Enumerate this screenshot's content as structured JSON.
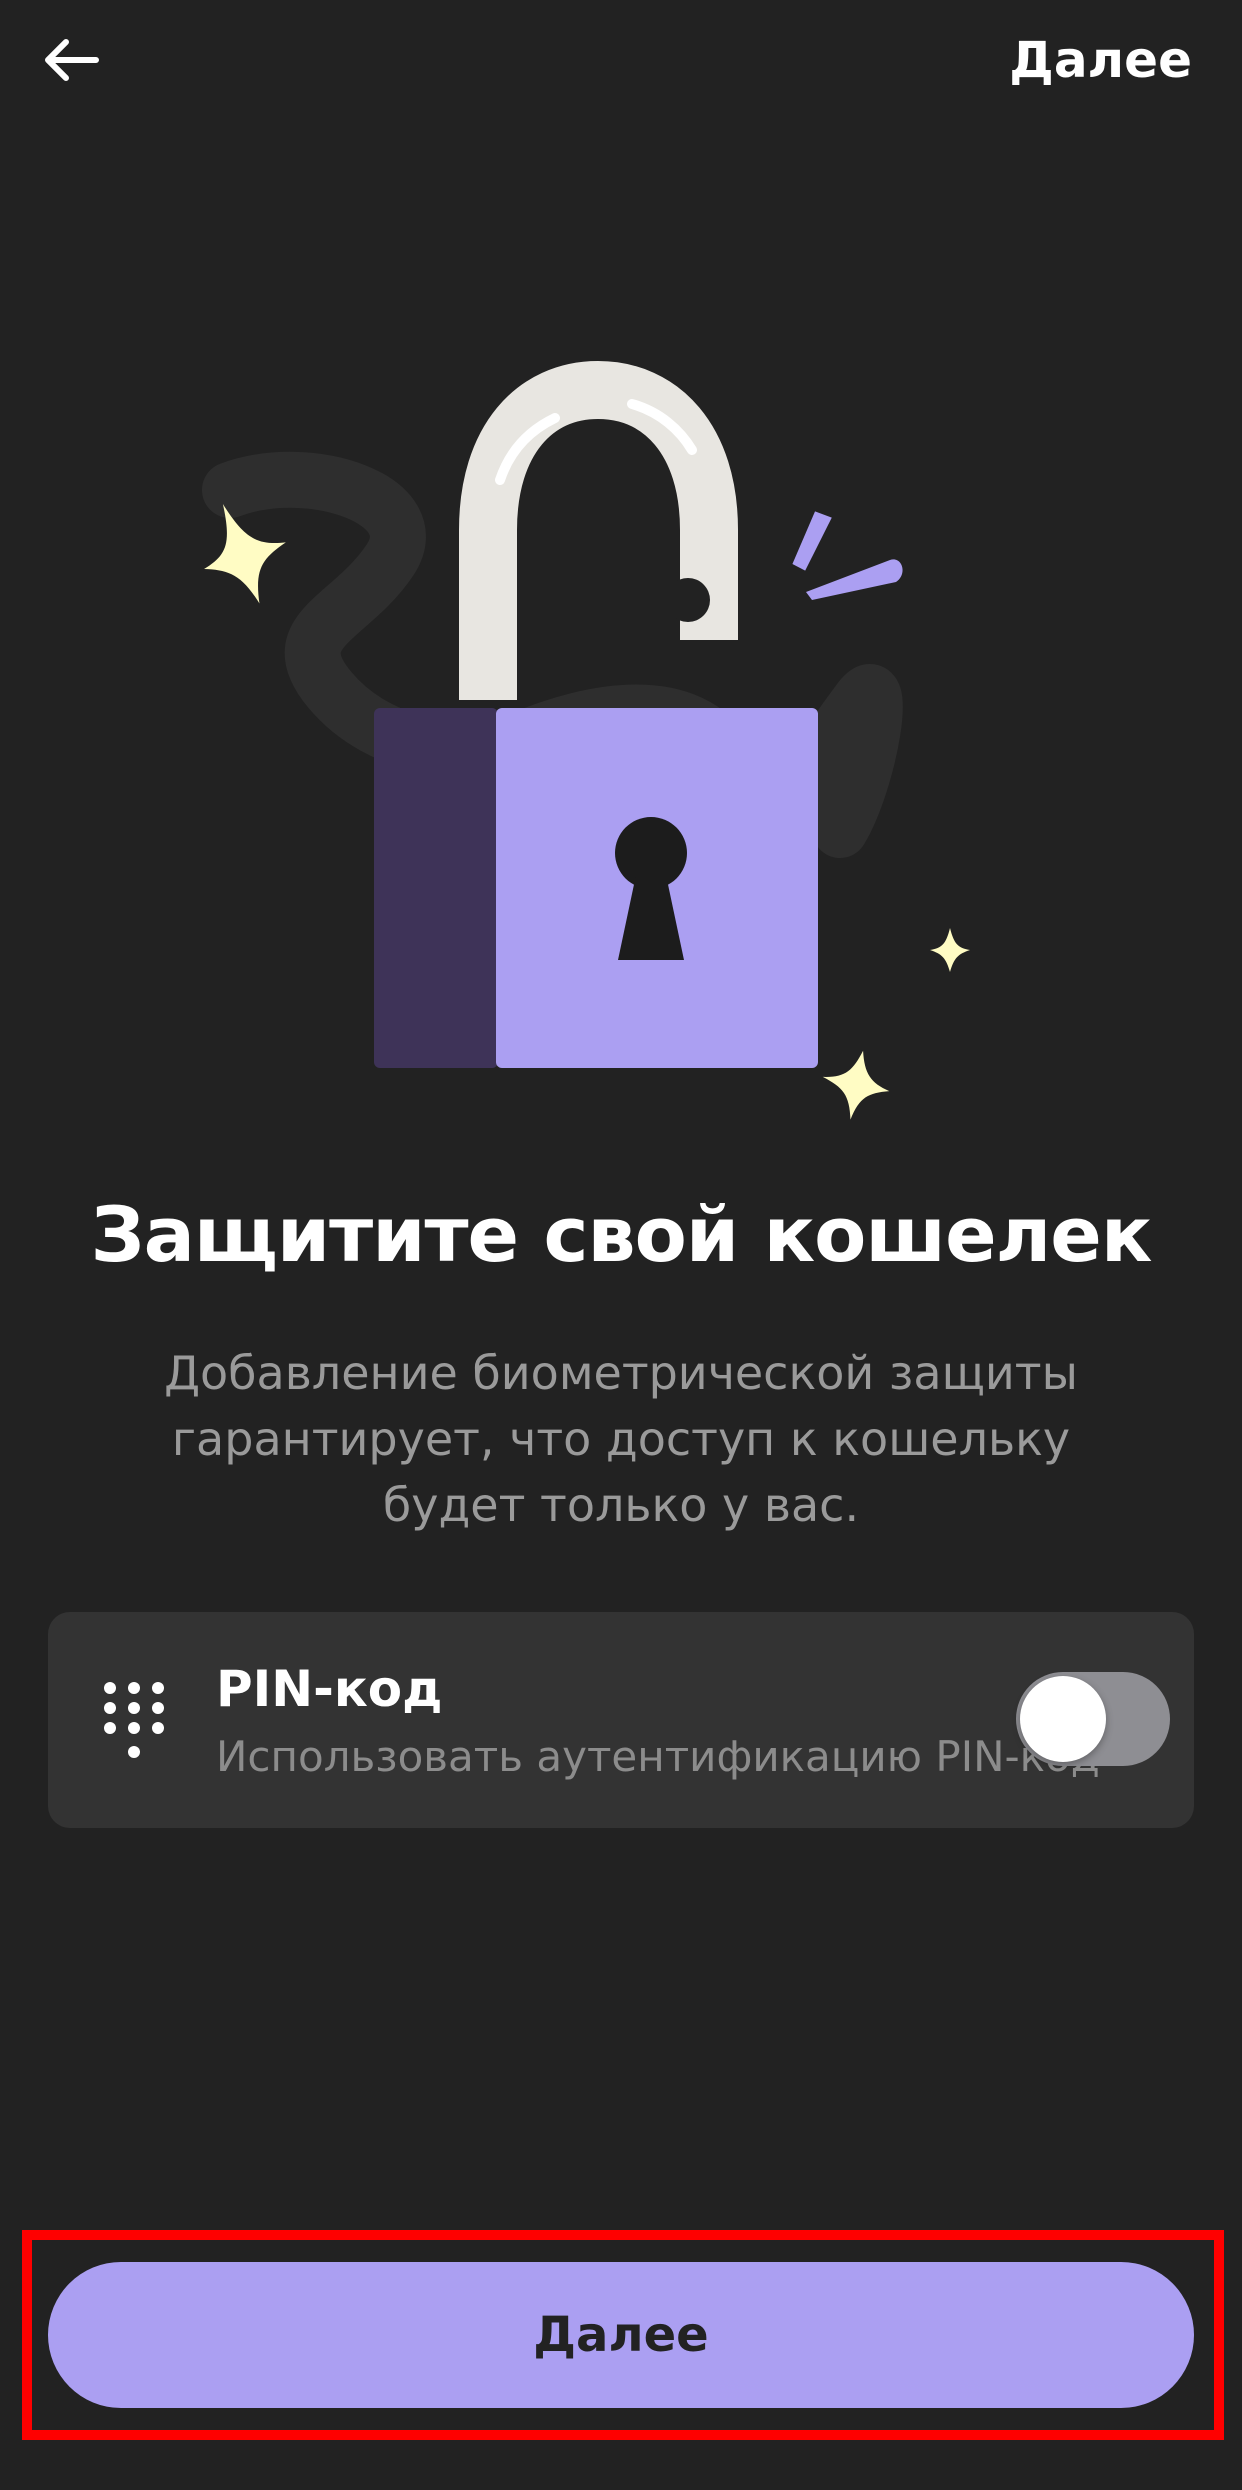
{
  "header": {
    "back_icon": "arrow-left-icon",
    "next_label": "Далее"
  },
  "illustration": {
    "name": "unlocked-padlock-icon",
    "colors": {
      "lock_body": "#ab9ff2",
      "lock_side": "#3e3358",
      "shackle": "#e8e6e1",
      "sparkle": "#fffcc4"
    }
  },
  "content": {
    "title": "Защитите свой кошелек",
    "subtitle_lines": [
      "Добавление биометрической защиты",
      "гарантирует, что доступ к кошельку",
      "будет только у вас."
    ]
  },
  "pin_option": {
    "icon": "keypad-icon",
    "title": "PIN-код",
    "description": "Использовать аутентификацию PIN-код",
    "enabled": false
  },
  "footer": {
    "button_label": "Далее"
  },
  "colors": {
    "background": "#222222",
    "card": "#333333",
    "accent": "#ab9ff2",
    "highlight_outline": "#ff0000"
  }
}
